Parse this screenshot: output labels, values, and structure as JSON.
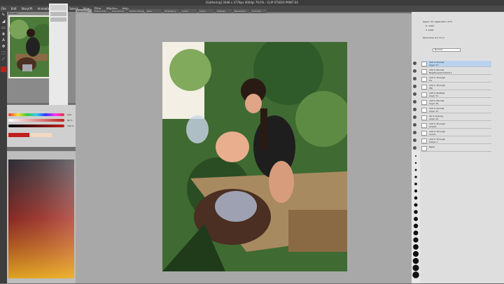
{
  "window": {
    "title": "[Gathering] 3048 x 3779px 400dpi 79.0% - CLIP STUDIO PAINT EX"
  },
  "menu": [
    "File",
    "Edit",
    "Story(P)",
    "Animation",
    "Layer",
    "Select",
    "View",
    "Filter",
    "Window",
    "Help"
  ],
  "tabs": [
    "Gathering",
    "Power Tree",
    "Grandmum",
    "Hidden Things",
    "Bliss",
    "Strawberry",
    "Camp",
    "Cabin",
    "Hallows",
    "Neverland",
    "Summer"
  ],
  "active_tab": 0,
  "navigator": {
    "title": "Navigator"
  },
  "layers_panel": {
    "header_lines": [
      "Upper: 3% Application: 97%",
      "H: 1200",
      "V: 1000"
    ],
    "blend_mode": "Normal",
    "work_time": "Work time:   6 h 13 m",
    "rows": [
      {
        "line1": "100 % Normal",
        "line2": "Layer 17",
        "selected": true
      },
      {
        "line1": "100 % Normal",
        "line2": "Brightness/Contrast 1",
        "selected": false
      },
      {
        "line1": "100 % Through",
        "line2": "FG",
        "selected": false
      },
      {
        "line1": "100 % Through",
        "line2": "MG",
        "selected": false
      },
      {
        "line1": "100 % Multiply",
        "line2": "Layer 11",
        "selected": false
      },
      {
        "line1": "100 % Normal",
        "line2": "Layer 10",
        "selected": false
      },
      {
        "line1": "100 % Normal",
        "line2": "Layer 11",
        "selected": false
      },
      {
        "line1": "49 % Overlay",
        "line2": "Layer 10",
        "selected": false
      },
      {
        "line1": "100 % Through",
        "line2": "Lineart",
        "selected": false
      },
      {
        "line1": "100 % Through",
        "line2": "Colors",
        "selected": false
      },
      {
        "line1": "100 % Through",
        "line2": "Folder 1",
        "selected": false
      },
      {
        "line1": "Paper",
        "line2": "",
        "selected": false
      }
    ]
  },
  "tool_property": {
    "slider_values": [
      "100",
      "60 %",
      "100 %"
    ]
  },
  "colors": {
    "brand_dark": "#3c3c3c",
    "selected_layer": "#b9d3ef",
    "canvas_bg": "#a8a8a8"
  },
  "icons": [
    "pen-icon",
    "brush-icon",
    "eraser-icon",
    "fill-icon",
    "text-icon",
    "move-icon",
    "select-icon",
    "eyedropper-icon"
  ]
}
